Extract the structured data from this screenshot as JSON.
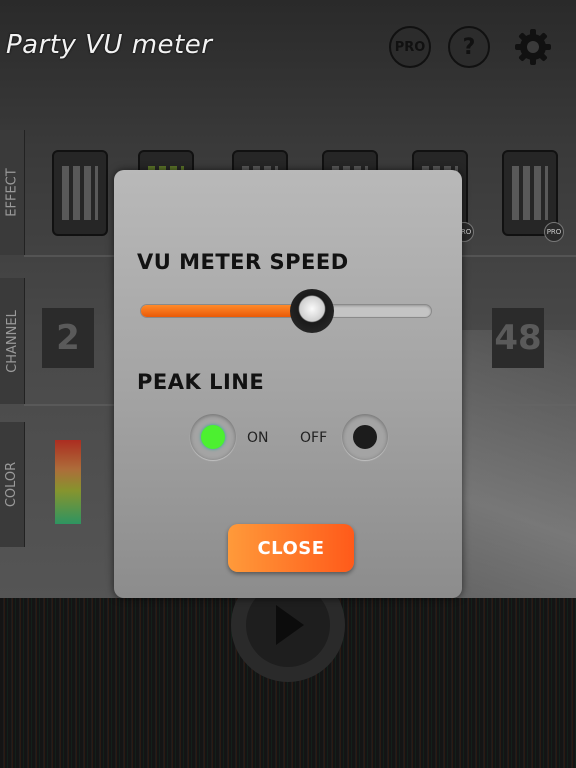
{
  "app": {
    "title": "Party VU meter"
  },
  "top_buttons": {
    "pro_label": "PRO",
    "help_label": "?"
  },
  "side_tabs": [
    "EFFECT",
    "CHANNEL",
    "COLOR"
  ],
  "effects": [
    {
      "pro": false
    },
    {
      "pro": false
    },
    {
      "pro": false
    },
    {
      "pro": false
    },
    {
      "pro": true,
      "pro_label": "PRO"
    },
    {
      "pro": true,
      "pro_label": "PRO"
    }
  ],
  "channels": [
    "2",
    "48"
  ],
  "dialog": {
    "speed_heading": "VU METER SPEED",
    "speed_value": 0.59,
    "peak_heading": "PEAK LINE",
    "on_label": "ON",
    "off_label": "OFF",
    "peak_line": "on",
    "close_label": "CLOSE"
  },
  "colors": {
    "accent_orange": "#ff6a1a",
    "radio_active": "#4cf030"
  }
}
